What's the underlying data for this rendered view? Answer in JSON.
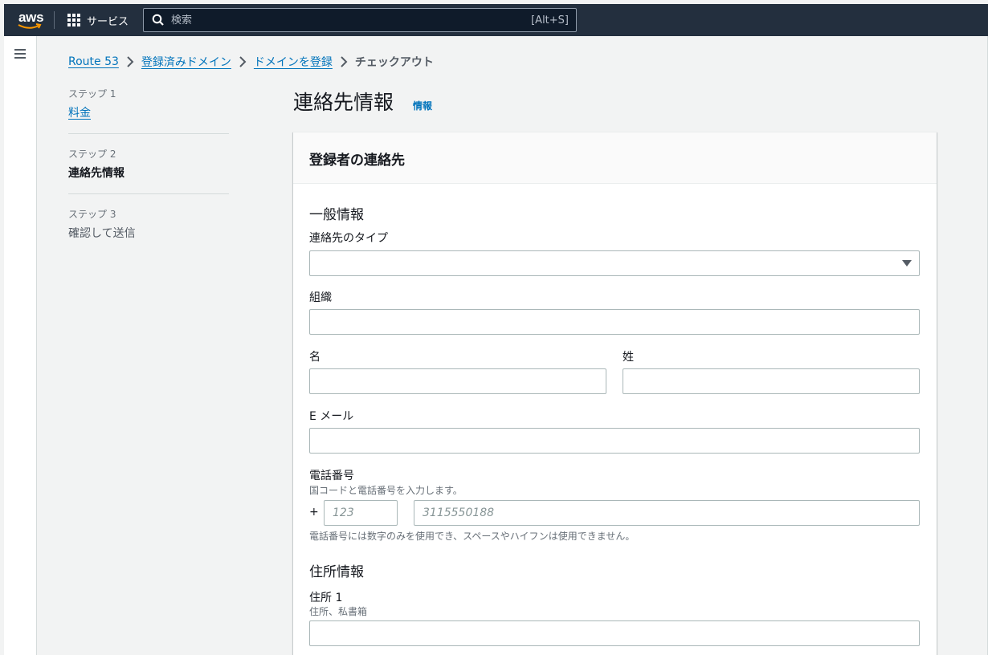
{
  "topnav": {
    "logo_text": "aws",
    "services_label": "サービス",
    "search_placeholder": "検索",
    "search_shortcut": "[Alt+S]"
  },
  "breadcrumb": {
    "items": [
      "Route 53",
      "登録済みドメイン",
      "ドメインを登録"
    ],
    "current": "チェックアウト"
  },
  "steps": [
    {
      "number": "ステップ 1",
      "label": "料金"
    },
    {
      "number": "ステップ 2",
      "label": "連絡先情報"
    },
    {
      "number": "ステップ 3",
      "label": "確認して送信"
    }
  ],
  "page": {
    "title": "連絡先情報",
    "info_link": "情報"
  },
  "form": {
    "card_title": "登録者の連絡先",
    "general_title": "一般情報",
    "contact_type_label": "連絡先のタイプ",
    "contact_type_value": "",
    "organization_label": "組織",
    "first_name_label": "名",
    "last_name_label": "姓",
    "email_label": "E メール",
    "phone_label": "電話番号",
    "phone_description": "国コードと電話番号を入力します。",
    "phone_plus": "+",
    "country_code_placeholder": "123",
    "phone_placeholder": "3115550188",
    "phone_hint": "電話番号には数字のみを使用でき、スペースやハイフンは使用できません。",
    "address_title": "住所情報",
    "address1_label": "住所 1",
    "address1_description": "住所、私書箱"
  }
}
